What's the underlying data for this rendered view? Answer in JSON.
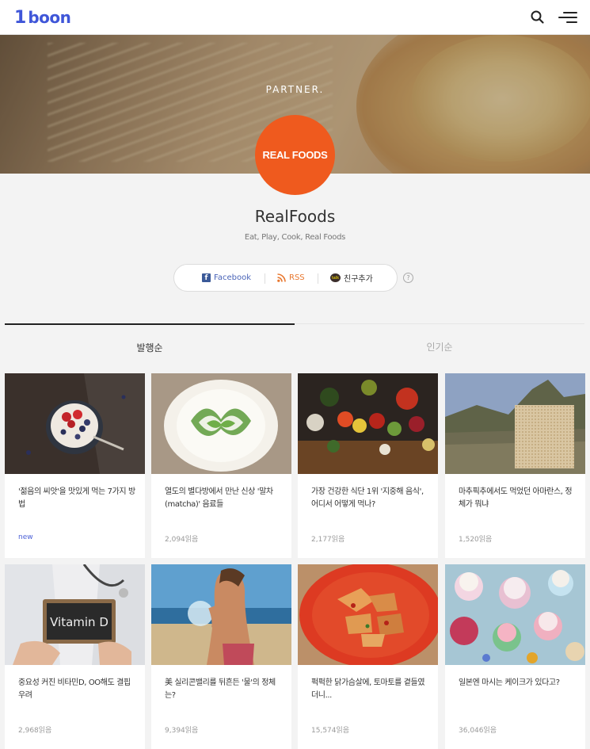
{
  "header": {
    "logo_one": "1",
    "logo_word": "boon",
    "search_icon": "search-icon",
    "menu_icon": "menu-icon"
  },
  "hero": {
    "label": "PARTNER.",
    "logo_text": "REAL FOODS"
  },
  "profile": {
    "name": "RealFoods",
    "tagline": "Eat, Play, Cook, Real Foods"
  },
  "social": {
    "facebook": "Facebook",
    "rss": "RSS",
    "kakao": "친구추가",
    "help": "?"
  },
  "tabs": [
    {
      "label": "발행순",
      "active": true
    },
    {
      "label": "인기순",
      "active": false
    }
  ],
  "articles": [
    {
      "title": "'젊음의 씨앗'을 맛있게 먹는 7가지 방법",
      "meta": "new"
    },
    {
      "title": "열도의 별다방에서 만난 신상 '말차(matcha)' 음료들",
      "meta": "2,094읽음"
    },
    {
      "title": "가장 건강한 식단 1위 '지중해 음식', 어디서 어떻게 먹나?",
      "meta": "2,177읽음"
    },
    {
      "title": "마추픽추에서도 먹었던 아마란스, 정체가 뭐냐",
      "meta": "1,520읽음"
    },
    {
      "title": "중요성 커진 비타민D, OO해도 결핍 우려",
      "meta": "2,968읽음",
      "thumb_text": "Vitamin D"
    },
    {
      "title": "美 실리콘밸리를 뒤흔든 '물'의 정체는?",
      "meta": "9,394읽음"
    },
    {
      "title": "퍽퍽한 닭가슴살에, 토마토를 곁들였더니...",
      "meta": "15,574읽음"
    },
    {
      "title": "일본엔 마시는 케이크가 있다고?",
      "meta": "36,046읽음"
    }
  ],
  "colors": {
    "brand": "#3f56d8",
    "partner_logo": "#ef5a1e",
    "new_badge": "#4a5fd6"
  }
}
